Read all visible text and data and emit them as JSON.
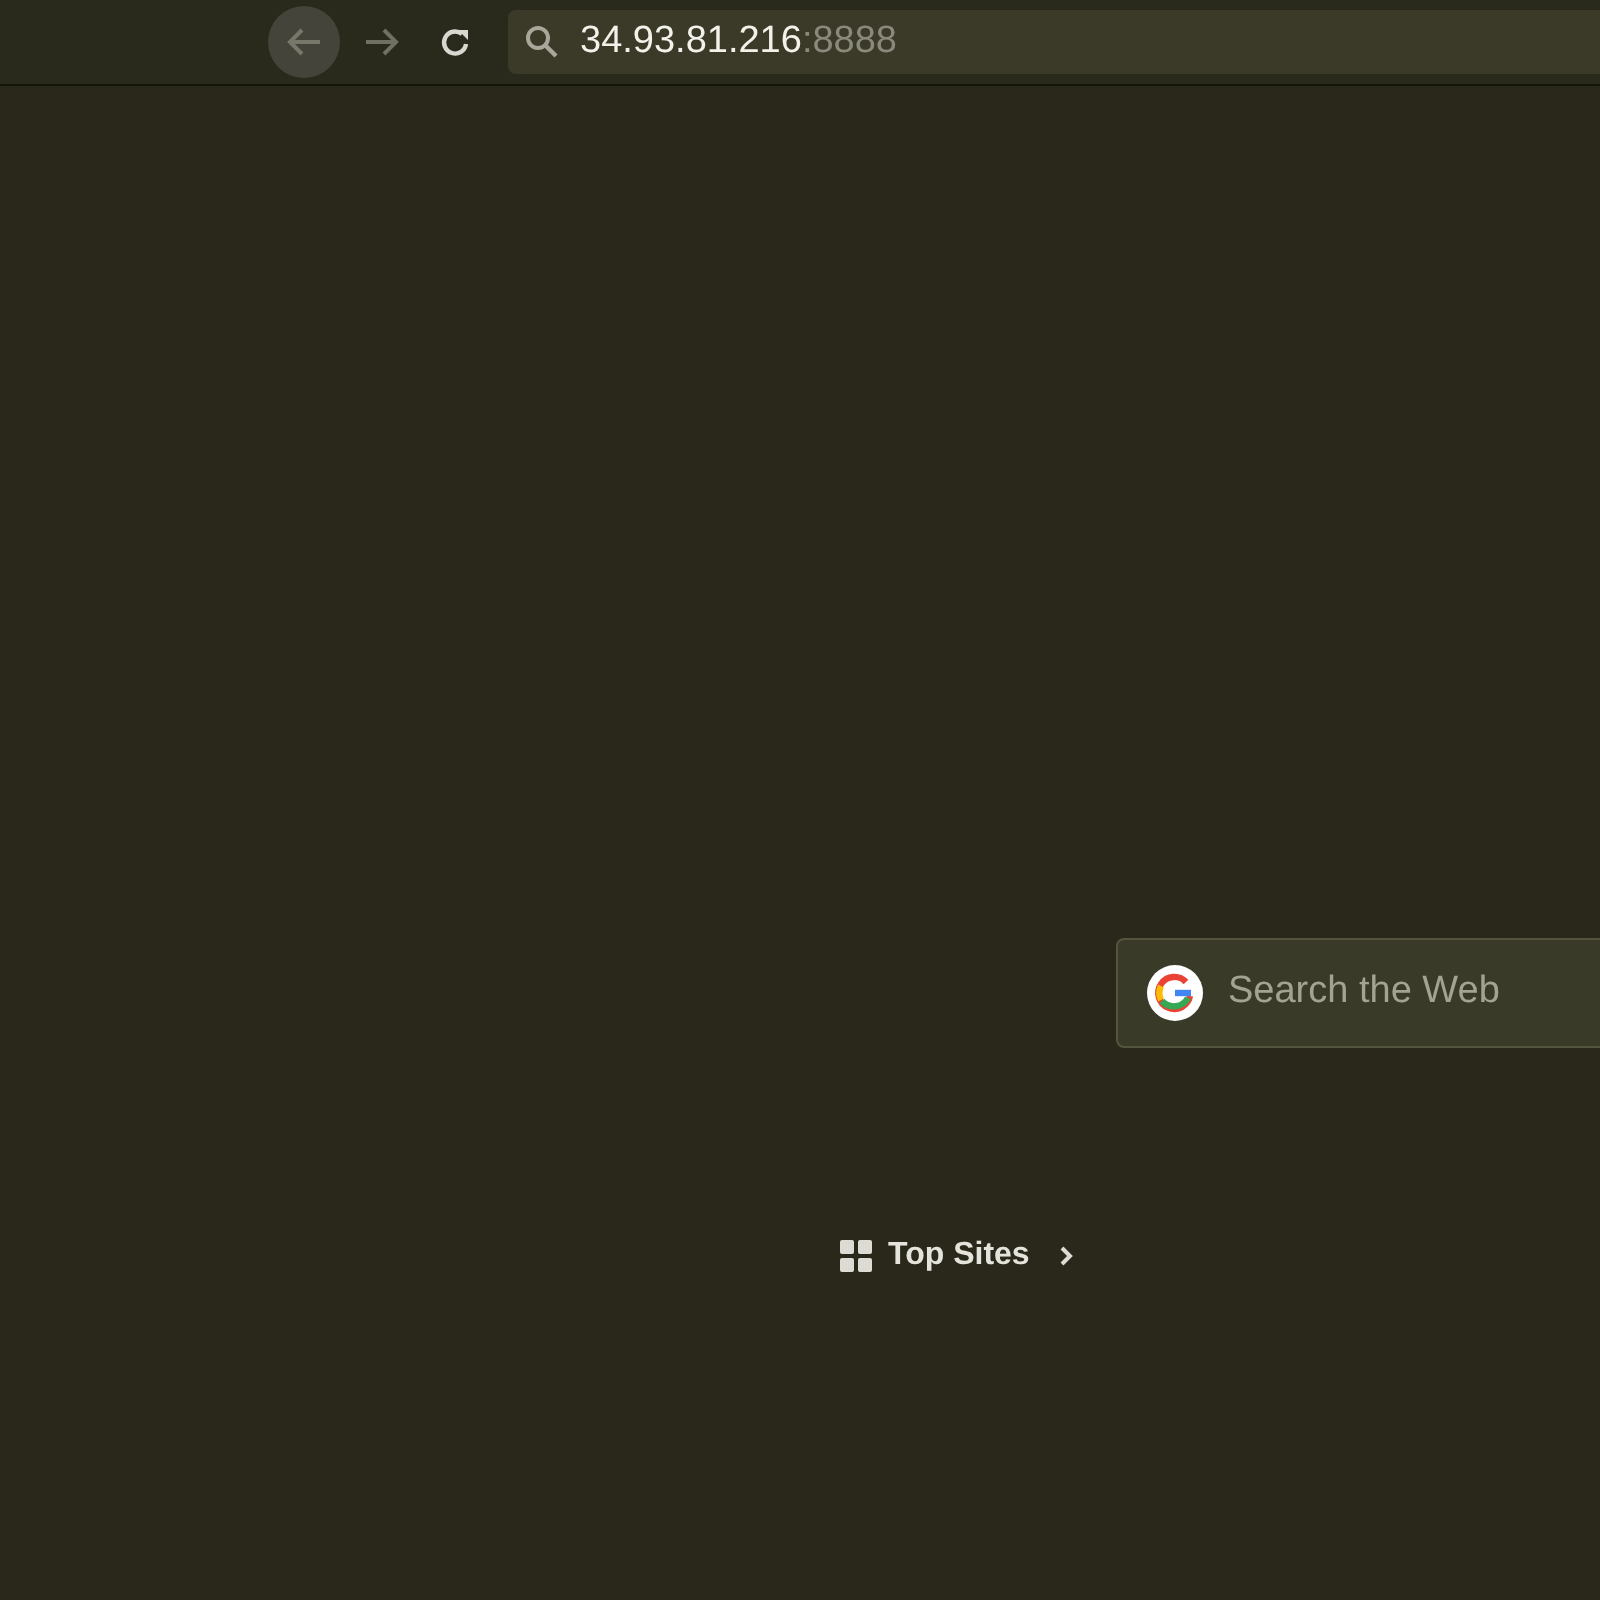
{
  "toolbar": {
    "back": {
      "highlighted": true
    },
    "forward": {
      "disabled": true
    }
  },
  "url": {
    "host": "34.93.81.216",
    "port": ":8888"
  },
  "search": {
    "placeholder": "Search the Web"
  },
  "top_sites": {
    "label": "Top Sites"
  }
}
